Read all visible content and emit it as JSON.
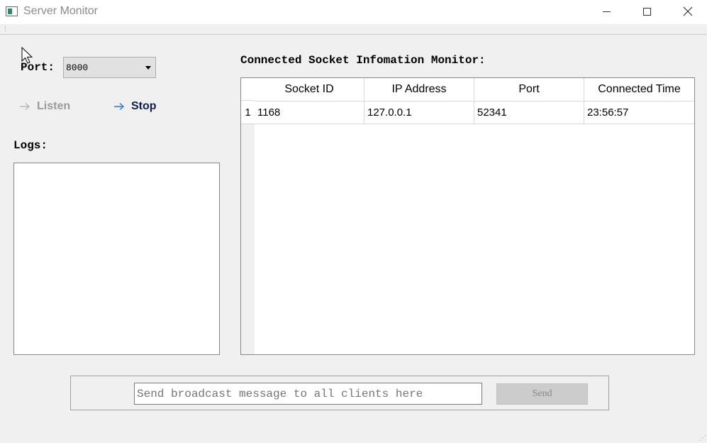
{
  "window": {
    "title": "Server Monitor",
    "controls": [
      "minimize",
      "maximize",
      "close"
    ]
  },
  "server": {
    "port_label": "Port:",
    "port_value": "8000",
    "listen_label": "Listen",
    "stop_label": "Stop",
    "listen_enabled": false,
    "stop_enabled": true
  },
  "logs": {
    "label": "Logs:",
    "entries": []
  },
  "monitor": {
    "title": "Connected Socket Infomation Monitor:",
    "columns": [
      "Socket ID",
      "IP Address",
      "Port",
      "Connected Time"
    ],
    "rows": [
      {
        "index": "1",
        "socket_id": "1168",
        "ip": "127.0.0.1",
        "port": "52341",
        "time": "23:56:57"
      }
    ]
  },
  "broadcast": {
    "placeholder": "Send broadcast message to all clients here",
    "send_label": "Send",
    "send_enabled": false
  },
  "colors": {
    "accent": "#1e7fe0",
    "disabled_text": "#9a9a9a",
    "stop_text": "#0c1f4a"
  },
  "icons": {
    "app": "app-window-icon",
    "listen": "arrow-right-icon",
    "stop": "arrow-right-icon"
  }
}
